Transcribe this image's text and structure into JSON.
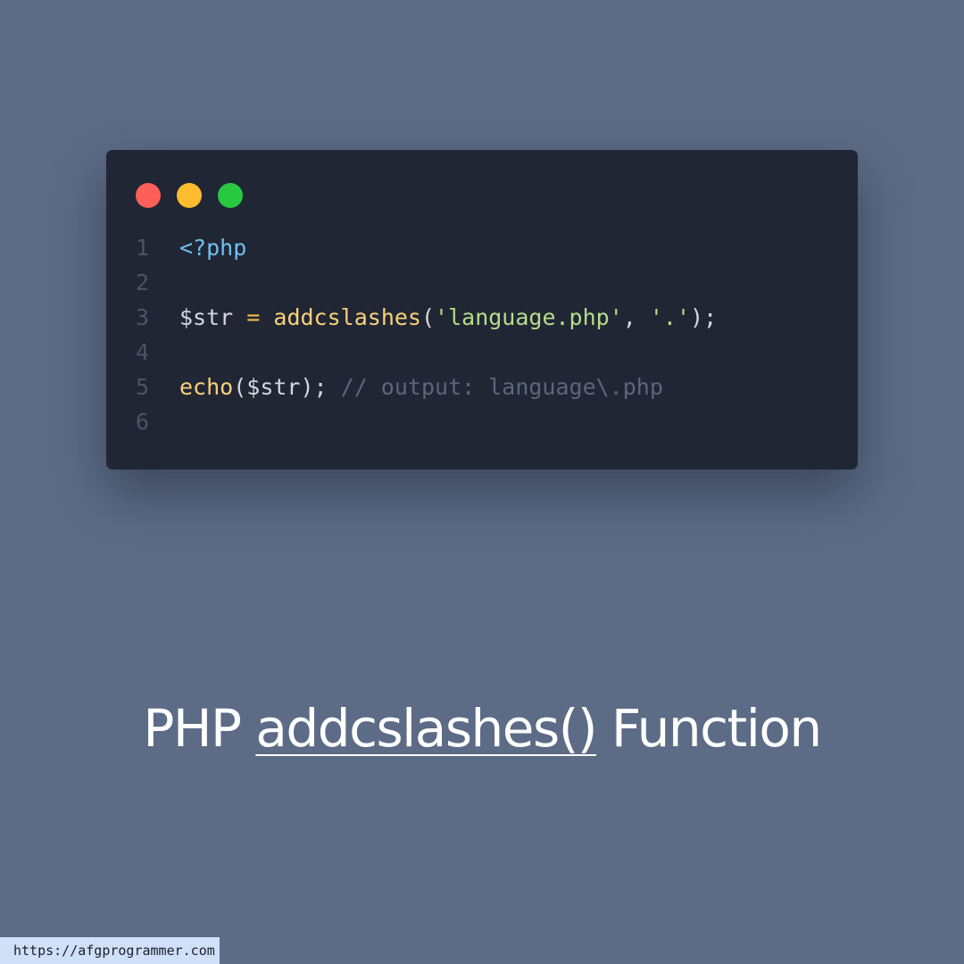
{
  "window": {
    "controls": [
      {
        "name": "close",
        "color": "#fe5f58"
      },
      {
        "name": "minimize",
        "color": "#febc2e"
      },
      {
        "name": "maximize",
        "color": "#28c841"
      }
    ]
  },
  "code": {
    "language": "php",
    "lines": [
      {
        "number": "1",
        "tokens": [
          {
            "type": "tag",
            "text": "<?php"
          }
        ]
      },
      {
        "number": "2",
        "tokens": []
      },
      {
        "number": "3",
        "tokens": [
          {
            "type": "var",
            "text": "$str"
          },
          {
            "type": "punc",
            "text": " "
          },
          {
            "type": "op",
            "text": "="
          },
          {
            "type": "punc",
            "text": " "
          },
          {
            "type": "fn",
            "text": "addcslashes"
          },
          {
            "type": "punc",
            "text": "("
          },
          {
            "type": "str",
            "text": "'language.php'"
          },
          {
            "type": "punc",
            "text": ", "
          },
          {
            "type": "str",
            "text": "'.'"
          },
          {
            "type": "punc",
            "text": ");"
          }
        ]
      },
      {
        "number": "4",
        "tokens": []
      },
      {
        "number": "5",
        "tokens": [
          {
            "type": "fn",
            "text": "echo"
          },
          {
            "type": "punc",
            "text": "("
          },
          {
            "type": "var",
            "text": "$str"
          },
          {
            "type": "punc",
            "text": "); "
          },
          {
            "type": "comment",
            "text": "// output: language\\.php"
          }
        ]
      },
      {
        "number": "6",
        "tokens": []
      }
    ]
  },
  "caption": {
    "prefix": "PHP ",
    "function_name": "addcslashes()",
    "suffix": " Function"
  },
  "footer": {
    "url": "https://afgprogrammer.com"
  }
}
